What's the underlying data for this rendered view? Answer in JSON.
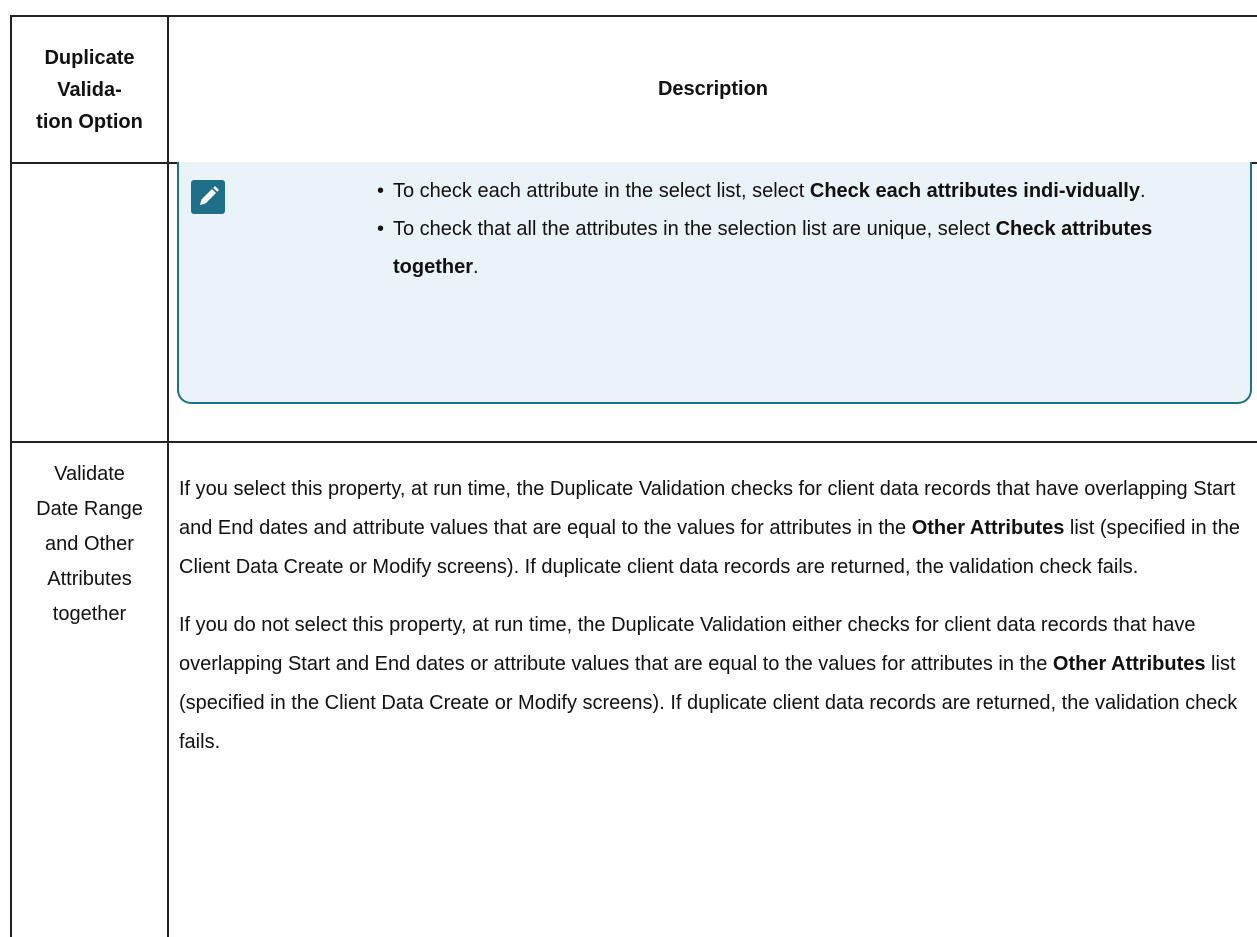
{
  "table": {
    "header": {
      "option_lines": [
        "Duplicate",
        "Valida-",
        "tion Option"
      ],
      "description": "Description"
    },
    "note": {
      "icon": "pencil-note-icon",
      "bullet": "•",
      "items": [
        {
          "pre": "To check each attribute in the select list, select ",
          "bold": "Check each attributes indi-vidually",
          "post": "."
        },
        {
          "pre": "To check that all the attributes in the selection list are unique, select ",
          "bold": "Check attributes together",
          "post": "."
        }
      ]
    },
    "rows": [
      {
        "option_lines": [
          "Validate",
          "Date Range",
          "and Other",
          "Attributes",
          "together"
        ],
        "paragraphs": [
          {
            "pre": "If you select this property, at run time, the Duplicate Validation checks for client data records that have overlapping Start and End dates and attribute values that are equal to the values for attributes in the ",
            "bold": "Other Attributes",
            "post": " list (specified in the Client Data Create or Modify screens). If duplicate client data records are returned, the validation check fails."
          },
          {
            "pre": "If you do not select this property, at run time, the Duplicate Validation either checks for client data records that have overlapping Start and End dates or attribute values that are equal to the values for attributes in the ",
            "bold": "Other Attributes",
            "post": " list (specified in the Client Data Create or Modify screens). If duplicate client data records are returned, the validation check fails."
          }
        ]
      }
    ],
    "colors": {
      "note_accent": "#1f6f8b",
      "note_bg": "#eaf3f8",
      "border": "#222222"
    }
  }
}
